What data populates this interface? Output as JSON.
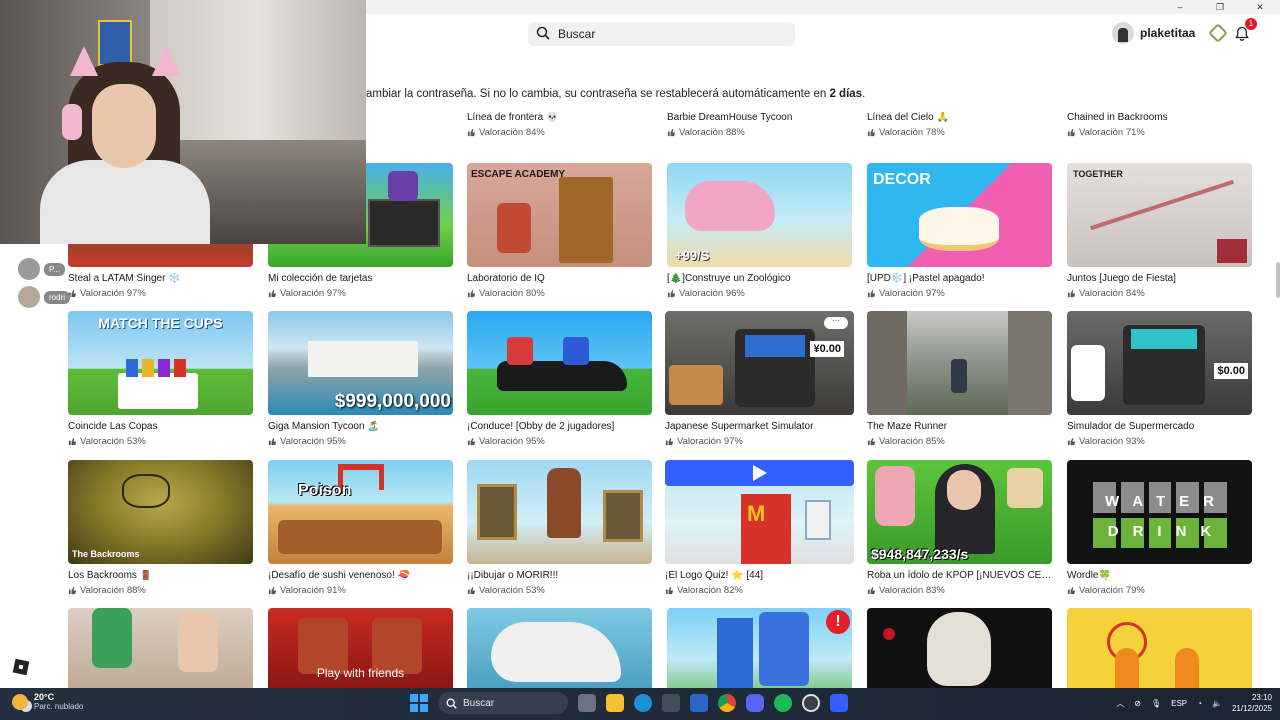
{
  "window": {
    "min": "–",
    "restore": "❐",
    "close": "✕"
  },
  "header": {
    "search_placeholder": "Buscar",
    "username": "plaketitaa",
    "notification_count": "1"
  },
  "banner": {
    "text_before": "ambiar la contraseña. Si no lo cambia, su contraseña se restablecerá automáticamente en ",
    "text_bold": "2 días",
    "text_after": "."
  },
  "rating_prefix": "Valoración",
  "webcam": {
    "chat_labels": [
      "P...",
      "rodri"
    ]
  },
  "rows": [
    [
      {
        "title": "",
        "rating": ""
      },
      {
        "title": "Línea de frontera 💀",
        "rating": "Valoración 84%"
      },
      {
        "title": "Barbie DreamHouse Tycoon",
        "rating": "Valoración 88%"
      },
      {
        "title": "Línea del Cielo 🙏",
        "rating": "Valoración 78%"
      },
      {
        "title": "Chained in Backrooms",
        "rating": "Valoración 71%"
      }
    ],
    [
      {
        "title": "Steal a LATAM Singer ❄️",
        "rating": "Valoración 97%"
      },
      {
        "title": "Mi colección de tarjetas",
        "rating": "Valoración 97%"
      },
      {
        "title": "Laboratorio de IQ",
        "rating": "Valoración 80%",
        "thumb_text": "ESCAPE ACADEMY"
      },
      {
        "title": "[🎄]Construye un Zoológico",
        "rating": "Valoración 96%",
        "thumb_text": "+99/S"
      },
      {
        "title": "[UPD❄️] ¡Pastel apagado!",
        "rating": "Valoración 97%",
        "thumb_text": "DECOR"
      },
      {
        "title": "Juntos [Juego de Fiesta]",
        "rating": "Valoración 84%",
        "thumb_text": "TOGETHER"
      }
    ],
    [
      {
        "title": "Coincide Las Copas",
        "rating": "Valoración 53%",
        "thumb_text": "MATCH THE CUPS"
      },
      {
        "title": "Giga Mansion Tycoon 🏝️",
        "rating": "Valoración 95%",
        "thumb_text": "$999,000,000"
      },
      {
        "title": "¡Conduce! [Obby de 2 jugadores]",
        "rating": "Valoración 95%"
      },
      {
        "title": "Japanese Supermarket Simulator",
        "rating": "Valoración 97%",
        "thumb_text": "¥0.00"
      },
      {
        "title": "The Maze Runner",
        "rating": "Valoración 85%"
      },
      {
        "title": "Simulador de Supermercado",
        "rating": "Valoración 93%",
        "thumb_text": "$0.00"
      }
    ],
    [
      {
        "title": "Los Backrooms 🚪",
        "rating": "Valoración 88%",
        "thumb_text": "The Backrooms"
      },
      {
        "title": "¡Desafío de sushi venenoso! 🍣",
        "rating": "Valoración 91%",
        "thumb_text": "Poison"
      },
      {
        "title": "¡¡Dibujar o MORIR!!!",
        "rating": "Valoración 53%"
      },
      {
        "title": "¡El Logo Quiz! ⭐ [44]",
        "rating": "Valoración 82%"
      },
      {
        "title": "Roba un ídolo de KPOP [¡NUEVOS CELE...",
        "rating": "Valoración 83%",
        "thumb_text": "$948,847,233/s"
      },
      {
        "title": "Wordle🍀",
        "rating": "Valoración 79%",
        "thumb_text": "WATER DRINK"
      }
    ],
    [
      {
        "title": "",
        "rating": ""
      },
      {
        "title": "",
        "rating": "",
        "thumb_text": "Play with friends"
      },
      {
        "title": "",
        "rating": ""
      },
      {
        "title": "",
        "rating": ""
      },
      {
        "title": "",
        "rating": ""
      },
      {
        "title": "",
        "rating": ""
      }
    ]
  ],
  "taskbar": {
    "temperature": "20°C",
    "weather": "Parc. nublado",
    "search": "Buscar",
    "lang": "ESP",
    "time": "23:10",
    "date": "21/12/2025"
  }
}
